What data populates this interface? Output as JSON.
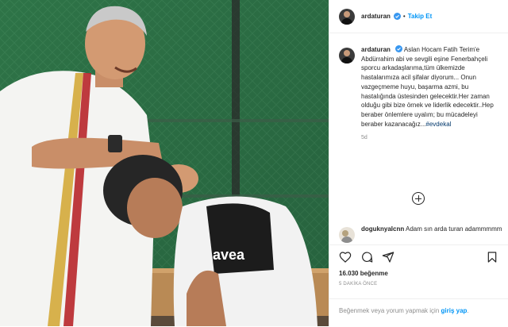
{
  "post": {
    "photo_alt": "Photo",
    "jersey_logo": "avea"
  },
  "header": {
    "username": "ardaturan",
    "separator": "•",
    "follow_label": "Takip Et"
  },
  "caption": {
    "username": "ardaturan",
    "text": "Aslan Hocam Fatih Terim'e Abdürrahim abi ve sevgili eşine Fenerbahçeli sporcu arkadaşlarıma,tüm ülkemizde hastalarımıza acil şifalar diyorum... Onun vazgeçmeme huyu, başarma azmi, bu hastalığında üstesinden gelecektir.Her zaman olduğu gibi bize örnek ve liderlik edecektir..Hep beraber önlemlere uyalım; bu mücadeleyi beraber kazanacağız...",
    "hashtag": "#evdekal",
    "age": "5d"
  },
  "comment": {
    "username": "doguknyalcnn",
    "text": "Adam sın arda turan adammmmm"
  },
  "actions": {
    "likes": "16.030 beğenme",
    "time": "5 DAKİKA ÖNCE"
  },
  "login": {
    "prompt": "Beğenmek veya yorum yapmak için",
    "link": "giriş yap",
    "suffix": "."
  },
  "icons": {
    "like": "heart-icon",
    "comment": "comment-icon",
    "share": "share-icon",
    "save": "bookmark-icon",
    "more": "plus-circle-icon",
    "verified": "verified-badge-icon"
  },
  "colors": {
    "accent": "#0095f6",
    "verified": "#3897f0",
    "muted": "#8e8e8e",
    "text": "#262626"
  }
}
